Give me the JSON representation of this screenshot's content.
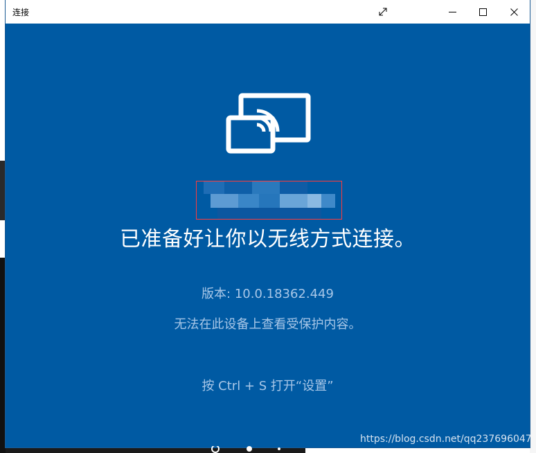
{
  "window": {
    "title": "连接",
    "accent": "#005aa3"
  },
  "titlebar": {
    "expand_icon": "expand-icon",
    "minimize_icon": "minimize-icon",
    "maximize_icon": "maximize-icon",
    "close_icon": "close-icon"
  },
  "main": {
    "icon": "wireless-display-icon",
    "device_name_redacted": true,
    "ready_text": "已准备好让你以无线方式连接。",
    "version_text": "版本: 10.0.18362.449",
    "protected_text": "无法在此设备上查看受保护内容。",
    "shortcut_text": "按 Ctrl + S 打开“设置”"
  },
  "overlay": {
    "watermark": "https://blog.csdn.net/qq237696047"
  }
}
